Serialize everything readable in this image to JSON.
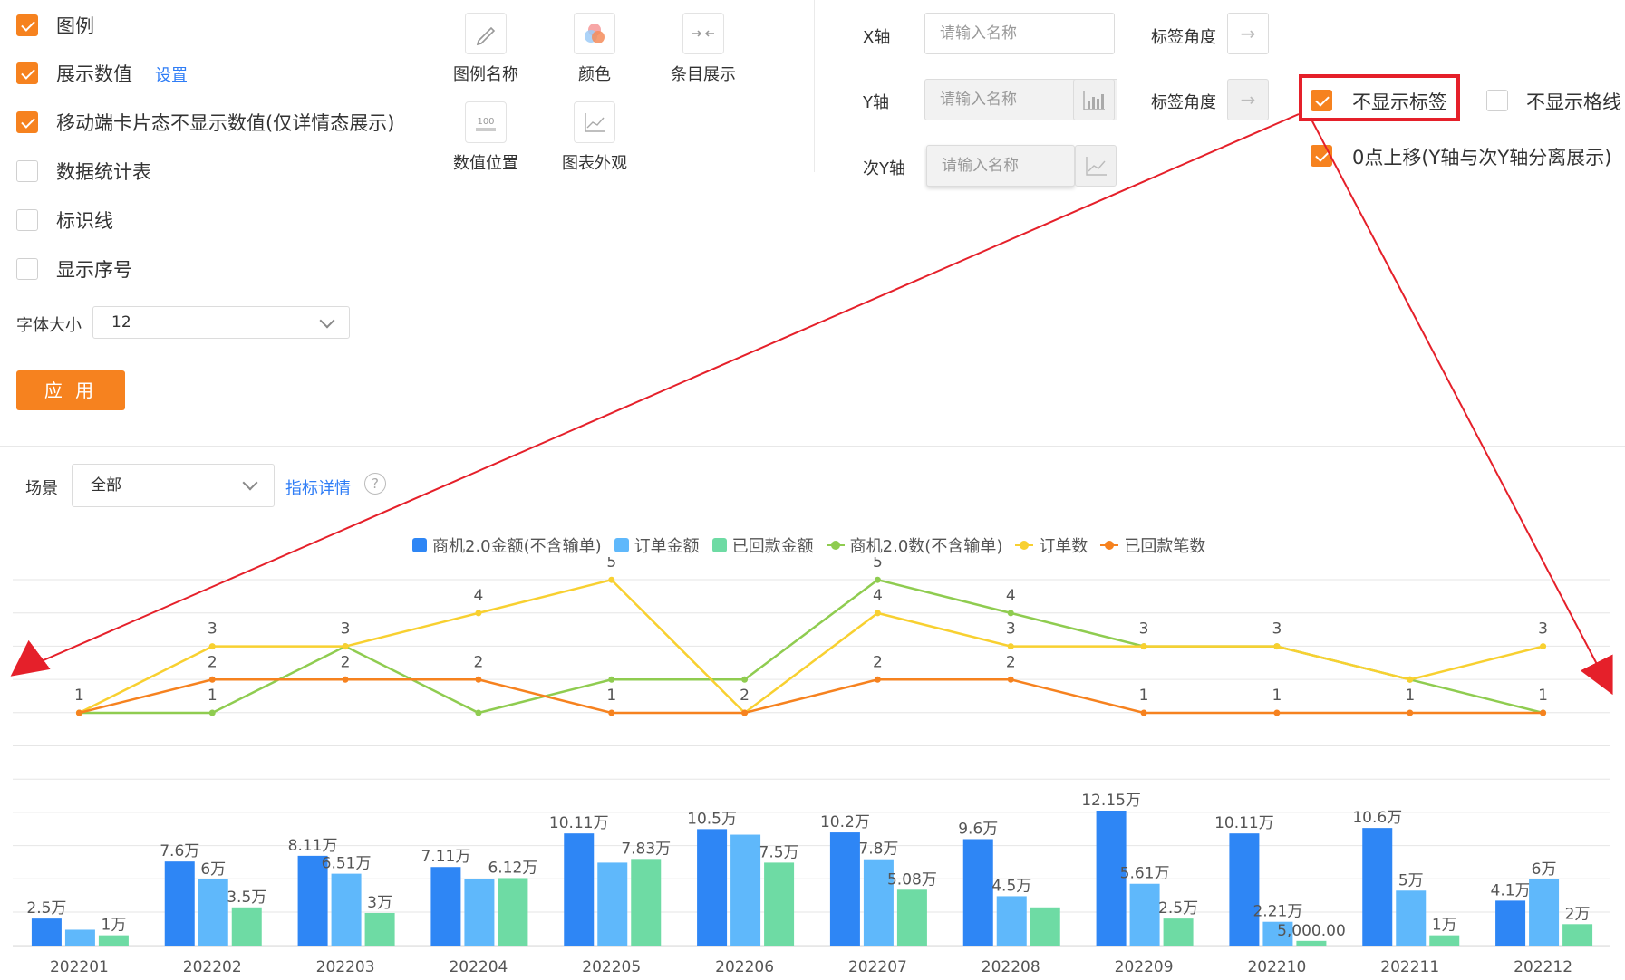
{
  "options": {
    "legend_label": "图例",
    "show_values_label": "展示数值",
    "settings_link": "设置",
    "mobile_label": "移动端卡片态不显示数值(仅详情态展示)",
    "stats_table_label": "数据统计表",
    "marker_line_label": "标识线",
    "show_index_label": "显示序号",
    "font_size_label": "字体大小",
    "font_size_value": "12",
    "apply_label": "应 用"
  },
  "tools": {
    "legend_name": "图例名称",
    "color": "颜色",
    "item_display": "条目展示",
    "value_position": "数值位置",
    "chart_appearance": "图表外观",
    "value_icon_text": "100"
  },
  "axes": {
    "x_label": "X轴",
    "y_label": "Y轴",
    "y2_label": "次Y轴",
    "x_placeholder": "请输入名称",
    "y_placeholder": "请输入名称",
    "y2_placeholder": "请输入名称",
    "tag_angle_1": "标签角度",
    "tag_angle_2": "标签角度",
    "hide_labels": "不显示标签",
    "hide_grid": "不显示格线",
    "zero_up": "0点上移(Y轴与次Y轴分离展示)"
  },
  "filter": {
    "scene_label": "场景",
    "scene_value": "全部",
    "detail_link": "指标详情"
  },
  "colors": {
    "accent": "#f6821f",
    "link": "#2f7df6",
    "highlight": "#e5202a"
  },
  "chart_data": {
    "type": "bar",
    "categories": [
      "202201",
      "202202",
      "202203",
      "202204",
      "202205",
      "202206",
      "202207",
      "202208",
      "202209",
      "202210",
      "202211",
      "202212"
    ],
    "series": [
      {
        "name": "商机2.0金额(不含输单)",
        "kind": "bar",
        "color": "#2e86f5",
        "values": [
          2.5,
          7.6,
          8.11,
          7.11,
          10.11,
          10.5,
          10.2,
          9.6,
          12.15,
          10.11,
          10.6,
          4.1
        ],
        "labels": [
          "2.5万",
          "7.6万",
          "8.11万",
          "7.11万",
          "10.11万",
          "10.5万",
          "10.2万",
          "9.6万",
          "12.15万",
          "10.11万",
          "10.6万",
          "4.1万"
        ]
      },
      {
        "name": "订单金额",
        "kind": "bar",
        "color": "#5fb8fb",
        "values": [
          1.5,
          6,
          6.51,
          6,
          7.5,
          10,
          7.8,
          4.5,
          5.61,
          2.21,
          5,
          6
        ],
        "labels": [
          "",
          "6万",
          "6.51万",
          "",
          "",
          "",
          "7.8万",
          "4.5万",
          "5.61万",
          "2.21万",
          "5万",
          "6万"
        ]
      },
      {
        "name": "已回款金额",
        "kind": "bar",
        "color": "#6edba4",
        "values": [
          1,
          3.5,
          3,
          6.12,
          7.83,
          7.5,
          5.08,
          3.5,
          2.5,
          0.5,
          1,
          2
        ],
        "labels": [
          "1万",
          "3.5万",
          "3万",
          "6.12万",
          "7.83万",
          "7.5万",
          "5.08万",
          "",
          "2.5万",
          "5,000.00",
          "1万",
          "2万"
        ]
      },
      {
        "name": "商机2.0数(不含输单)",
        "kind": "line",
        "color": "#8fcc50",
        "values": [
          1,
          1,
          3,
          1,
          2,
          2,
          5,
          4,
          3,
          3,
          2,
          1
        ],
        "labels": [
          "",
          "1",
          "",
          "",
          "",
          "",
          "5",
          "4",
          "",
          "",
          "",
          ""
        ]
      },
      {
        "name": "订单数",
        "kind": "line",
        "color": "#f8d030",
        "values": [
          1,
          3,
          3,
          4,
          5,
          1,
          4,
          3,
          3,
          3,
          2,
          3
        ],
        "labels": [
          "1",
          "3",
          "3",
          "4",
          "5",
          "",
          "4",
          "3",
          "3",
          "3",
          "",
          "3"
        ]
      },
      {
        "name": "已回款笔数",
        "kind": "line",
        "color": "#f6821f",
        "values": [
          1,
          2,
          2,
          2,
          1,
          1,
          2,
          2,
          1,
          1,
          1,
          1
        ],
        "labels": [
          "",
          "2",
          "2",
          "2",
          "1",
          "2",
          "2",
          "2",
          "1",
          "1",
          "1",
          "1"
        ]
      }
    ]
  }
}
